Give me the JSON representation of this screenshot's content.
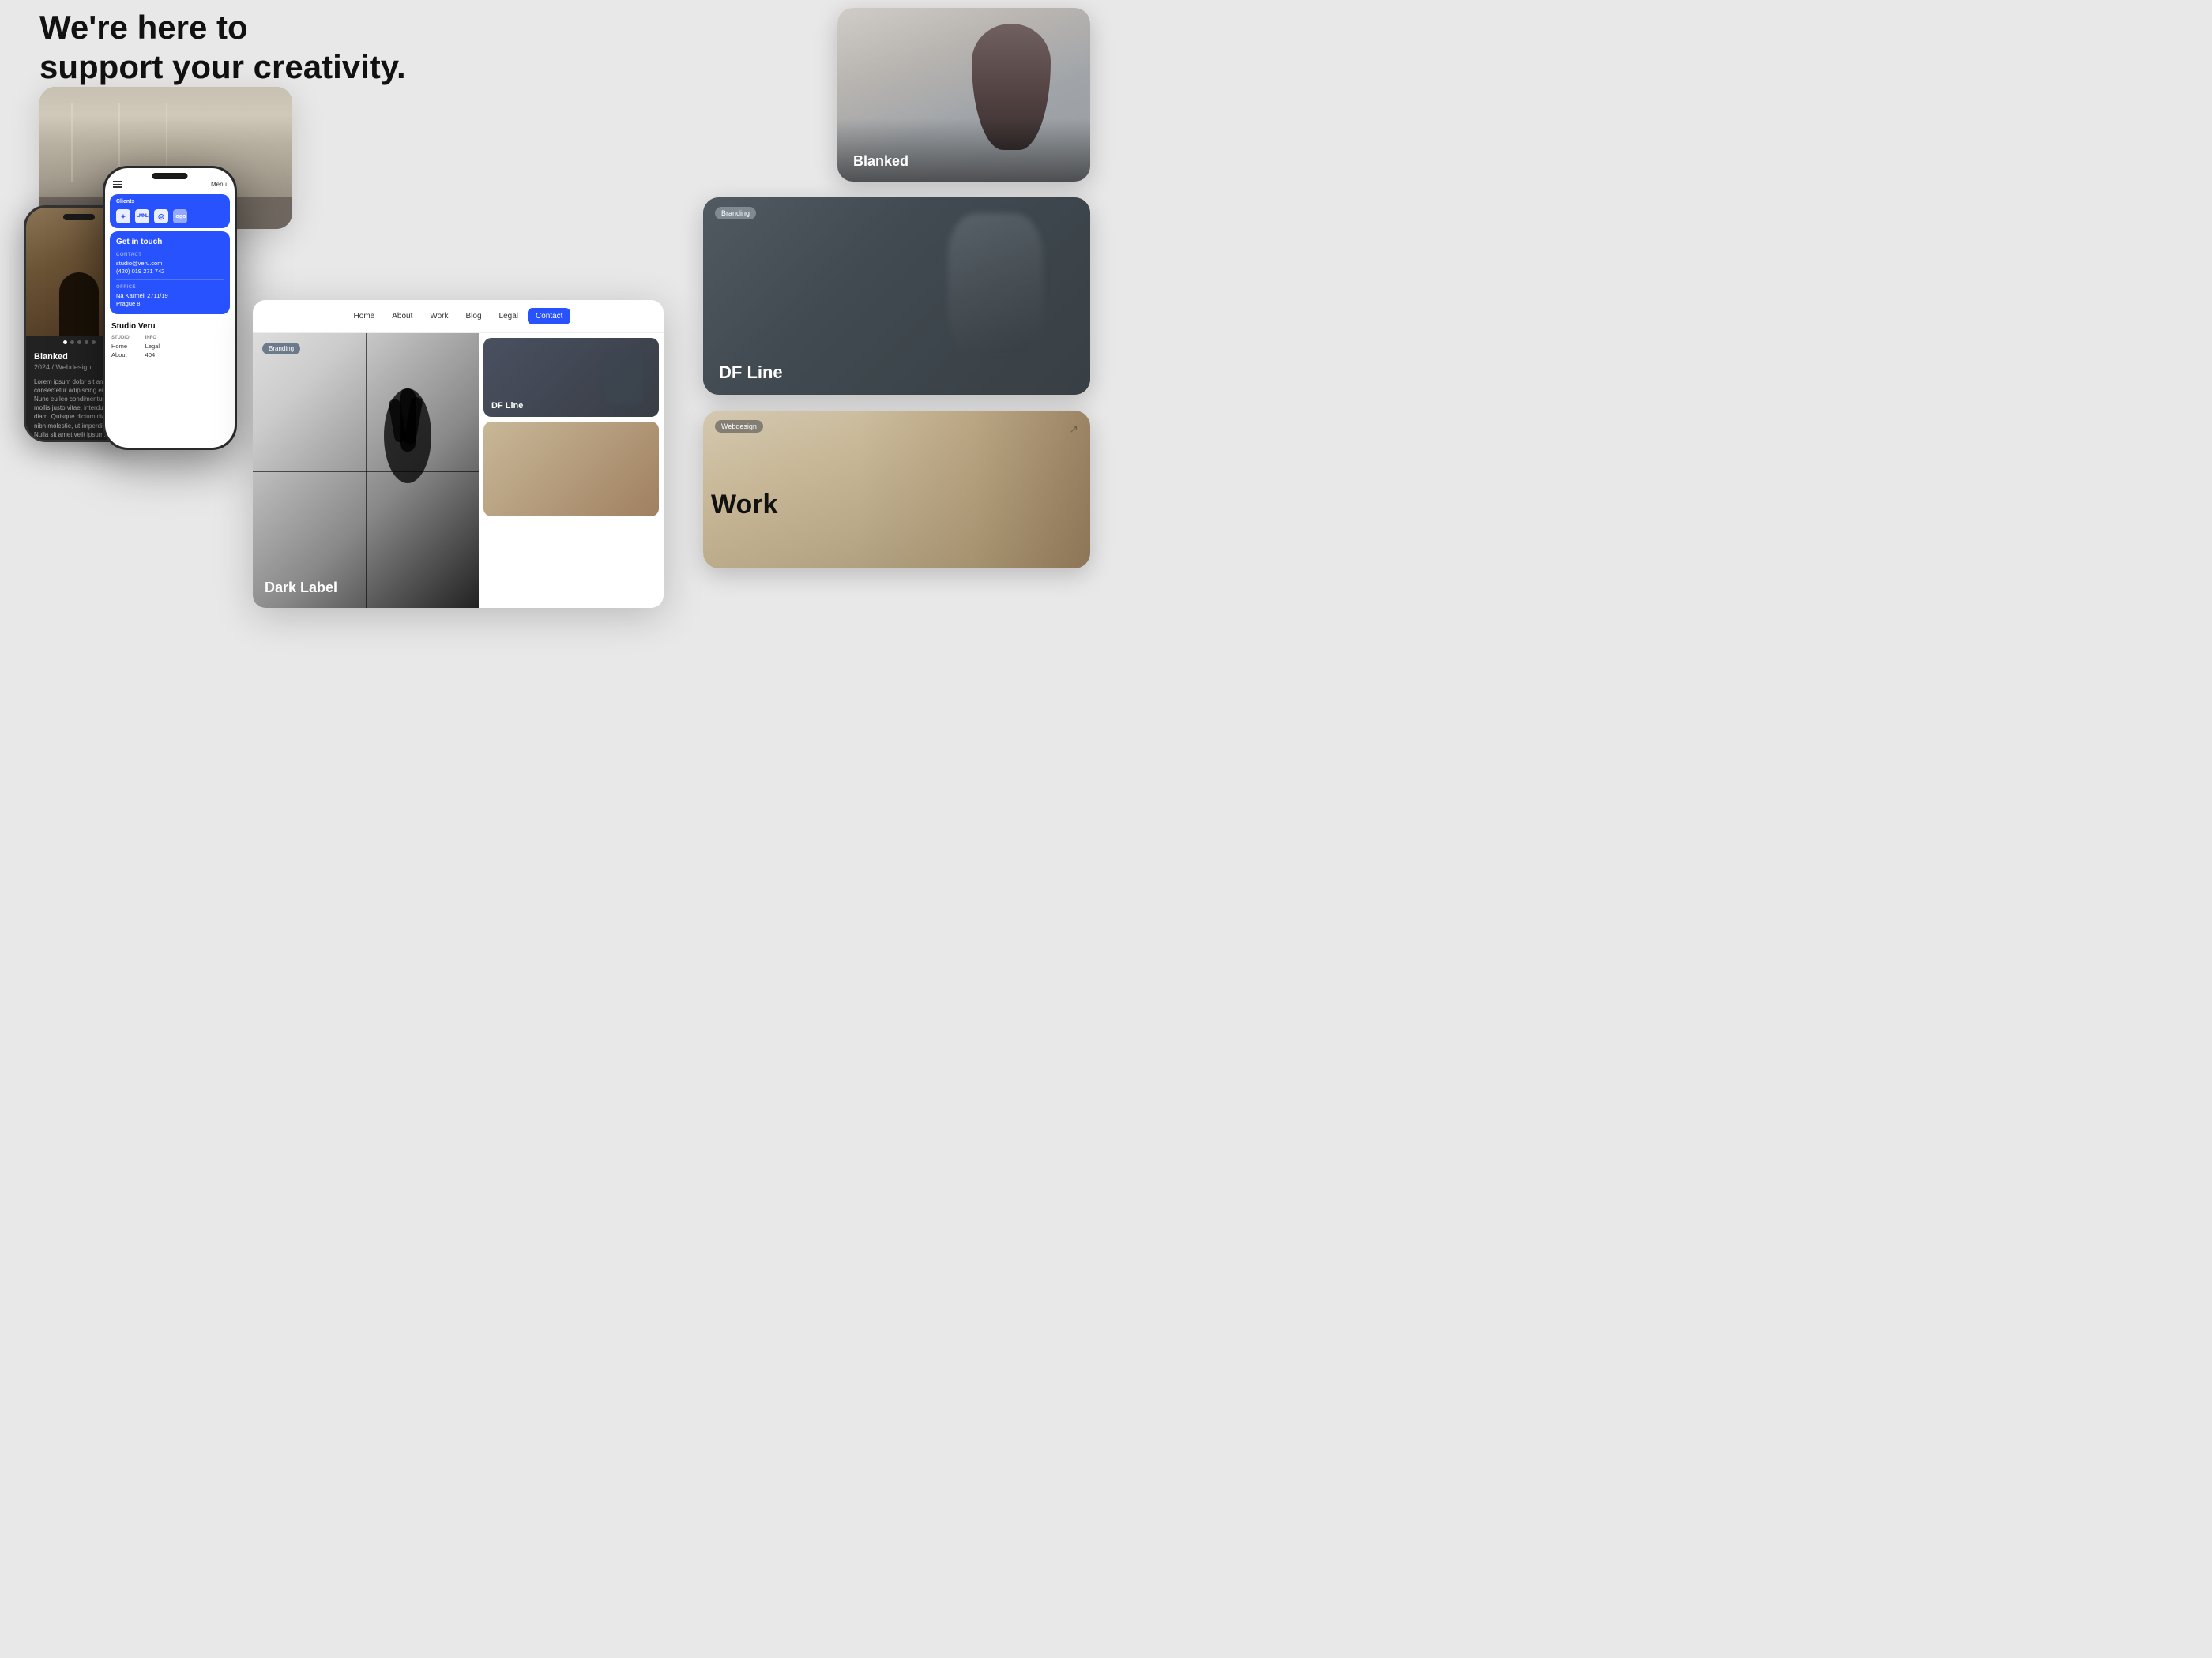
{
  "hero": {
    "line1": "We're here to",
    "line2": "support your creativity."
  },
  "phone_back": {
    "project_name": "Blanked",
    "year": "2024  /  Webdesign",
    "description": "Lorem ipsum dolor sit amet, consectetur adipiscing elit. Nunc eu leo condimentum, mollis justo vitae, interdum diam. Quisque dictum diam a nibh molestie, ut imperdiet felis. Nulla sit amet velit ipsum. Maecenas ac commodo diam. In iaculis luctus blandit. Suspendisse facilisis justo, sed vulputate quam efficitur vel. Integer tincidunt velit a leo congue varius.",
    "dots": [
      1,
      2,
      3,
      4,
      5
    ]
  },
  "phone_front": {
    "menu_label": "Menu",
    "clients": {
      "label": "Clients",
      "logos": [
        "★",
        "LMNL",
        "◎",
        "▪"
      ]
    },
    "get_in_touch": {
      "title": "Get in touch",
      "contact_label": "CONTACT",
      "email": "studio@veru.com",
      "phone": "(420) 019 271 742",
      "office_label": "OFFICE",
      "address_line1": "Na Karmeli 2711/19",
      "address_line2": "Prague 8"
    },
    "studio_name": "Studio Veru",
    "footer": {
      "studio_label": "STUDIO",
      "info_label": "INFO",
      "links_studio": [
        "Home",
        "About"
      ],
      "links_info": [
        "Legal",
        "404"
      ]
    }
  },
  "blanked_card": {
    "label": "Blanked"
  },
  "df_line_card": {
    "badge": "Branding",
    "label": "DF Line"
  },
  "webdesign_card": {
    "badge": "Webdesign"
  },
  "website_preview": {
    "nav": {
      "items": [
        "Home",
        "About",
        "Work",
        "Blog",
        "Legal",
        "Contact"
      ],
      "active": "Contact"
    },
    "main_project": "Dark Label",
    "main_badge": "Branding",
    "sidebar_project": "DF Line"
  },
  "work_section": {
    "label": "Work"
  }
}
